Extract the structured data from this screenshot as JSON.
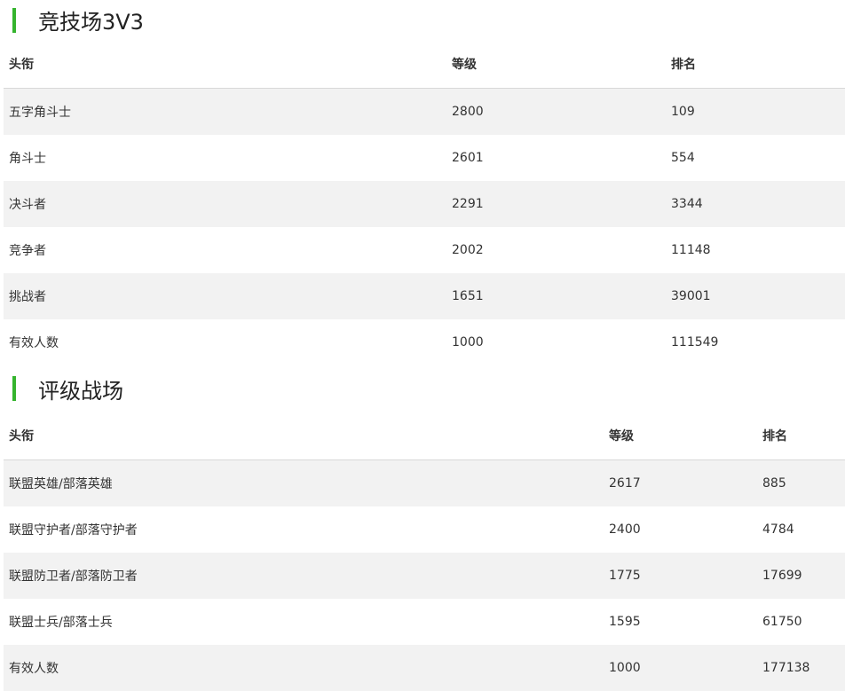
{
  "arena": {
    "title": "竞技场3V3",
    "headers": {
      "title": "头衔",
      "rating": "等级",
      "rank": "排名"
    },
    "rows": [
      {
        "title": "五字角斗士",
        "rating": "2800",
        "rank": "109"
      },
      {
        "title": "角斗士",
        "rating": "2601",
        "rank": "554"
      },
      {
        "title": "决斗者",
        "rating": "2291",
        "rank": "3344"
      },
      {
        "title": "竞争者",
        "rating": "2002",
        "rank": "11148"
      },
      {
        "title": "挑战者",
        "rating": "1651",
        "rank": "39001"
      },
      {
        "title": "有效人数",
        "rating": "1000",
        "rank": "111549"
      }
    ]
  },
  "rated_bg": {
    "title": "评级战场",
    "headers": {
      "title": "头衔",
      "rating": "等级",
      "rank": "排名"
    },
    "rows": [
      {
        "title": "联盟英雄/部落英雄",
        "rating": "2617",
        "rank": "885"
      },
      {
        "title": "联盟守护者/部落守护者",
        "rating": "2400",
        "rank": "4784"
      },
      {
        "title": "联盟防卫者/部落防卫者",
        "rating": "1775",
        "rank": "17699"
      },
      {
        "title": "联盟士兵/部落士兵",
        "rating": "1595",
        "rank": "61750"
      },
      {
        "title": "有效人数",
        "rating": "1000",
        "rank": "177138"
      }
    ]
  },
  "colors": {
    "accent": "#35b42e",
    "row_alt": "#f2f2f2",
    "divider": "#d8d8d8"
  }
}
